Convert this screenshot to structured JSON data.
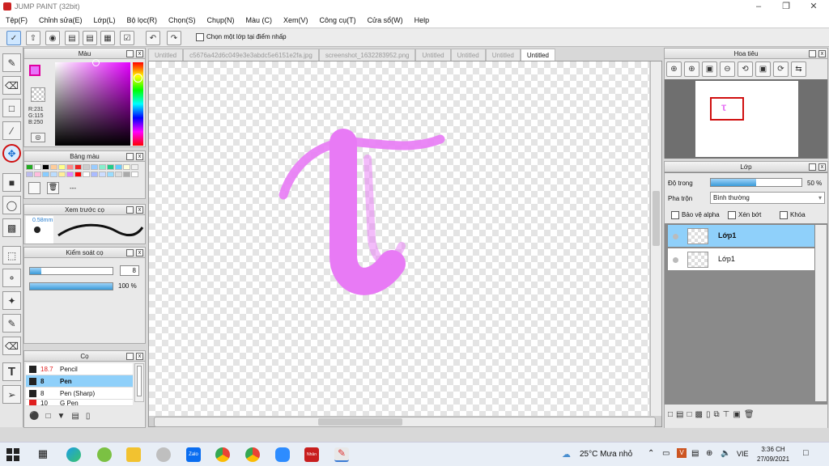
{
  "window": {
    "title": "JUMP PAINT (32bit)"
  },
  "menu": [
    "Tệp(F)",
    "Chỉnh sửa(E)",
    "Lớp(L)",
    "Bộ lọc(R)",
    "Chọn(S)",
    "Chụp(N)",
    "Màu (C)",
    "Xem(V)",
    "Công cụ(T)",
    "Cửa sổ(W)",
    "Help"
  ],
  "toolbar": {
    "select_layer_label": "Chọn một lớp tại điểm nhấp"
  },
  "tabs": [
    "Untitled",
    "c5676a42d6c049e3e3abdc5e6151e2fa.jpg",
    "screenshot_1632283952.png",
    "Untitled",
    "Untitled",
    "Untitled",
    "Untitled"
  ],
  "color_panel": {
    "title": "Màu",
    "r": "R:231",
    "g": "G:115",
    "b": "B:250",
    "fg_color": "#e773fa"
  },
  "palette_panel": {
    "title": "Bảng màu",
    "dash": "---"
  },
  "preview_panel": {
    "title": "Xem trước cọ",
    "size": "0.58mm"
  },
  "brush_control": {
    "title": "Kiểm soát cọ",
    "size_value": "8",
    "opacity_value": "100 %"
  },
  "brush_panel": {
    "title": "Cọ",
    "items": [
      {
        "size": "18.7",
        "name": "Pencil",
        "color": "#222222"
      },
      {
        "size": "8",
        "name": "Pen",
        "color": "#222222"
      },
      {
        "size": "8",
        "name": "Pen (Sharp)",
        "color": "#222222"
      },
      {
        "size": "10",
        "name": "G Pen",
        "color": "#e02020"
      }
    ]
  },
  "navigator": {
    "title": "Hoa tiêu"
  },
  "layer_panel": {
    "title": "Lớp",
    "opacity_label": "Độ trong",
    "opacity_value": "50 %",
    "blend_label": "Pha trộn",
    "blend_value": "Bình thường",
    "protect_alpha": "Bảo vệ alpha",
    "clipping": "Xén bớt",
    "lock": "Khóa",
    "layers": [
      "Lớp1",
      "Lớp1"
    ]
  },
  "taskbar": {
    "weather": "25°C  Mưa nhỏ",
    "lang": "VIE",
    "time": "3:36 CH",
    "date": "27/09/2021",
    "zalo_label": "Zalo",
    "vmix_label": "Nhân"
  }
}
